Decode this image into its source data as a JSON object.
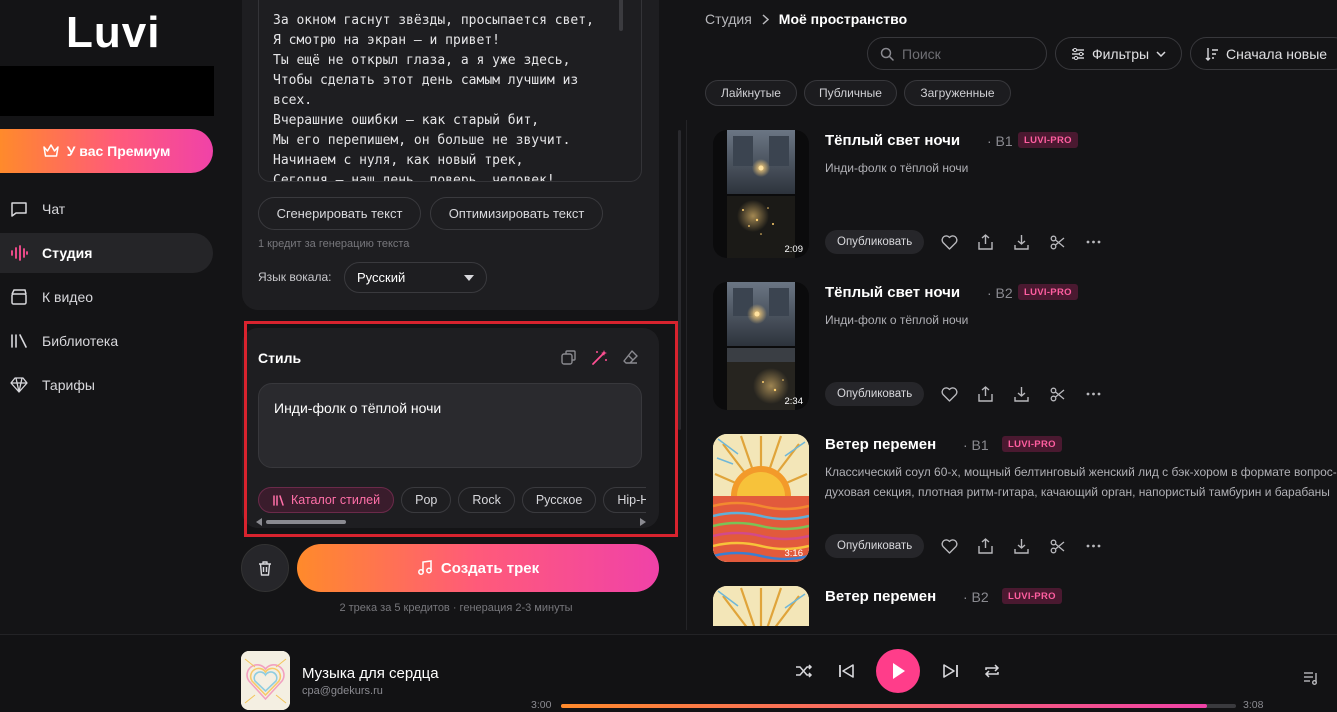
{
  "app": {
    "name": "Luvi"
  },
  "sidebar": {
    "premium_label": "У вас Премиум",
    "items": [
      {
        "label": "Чат",
        "icon": "chat-icon"
      },
      {
        "label": "Студия",
        "icon": "studio-icon",
        "active": true
      },
      {
        "label": "К видео",
        "icon": "video-icon"
      },
      {
        "label": "Библиотека",
        "icon": "library-icon"
      },
      {
        "label": "Тарифы",
        "icon": "diamond-icon"
      }
    ]
  },
  "lyrics": {
    "text": "За окном гаснут звёзды, просыпается свет,\nЯ смотрю на экран — и привет!\nТы ещё не открыл глаза, а я уже здесь,\nЧтобы сделать этот день самым лучшим из\nвсех.\nВчерашние ошибки — как старый бит,\nМы его перепишем, он больше не звучит.\nНачинаем с нуля, как новый трек,\nСегодня — наш день, поверь, человек!",
    "generate_label": "Сгенерировать текст",
    "optimize_label": "Оптимизировать текст",
    "credit_note": "1 кредит за генерацию текста",
    "vocal_language_label": "Язык вокала:",
    "vocal_language_value": "Русский"
  },
  "style": {
    "title": "Стиль",
    "value": "Инди-фолк о тёплой ночи",
    "chips": [
      "Каталог стилей",
      "Pop",
      "Rock",
      "Русское",
      "Hip-H"
    ]
  },
  "create": {
    "label": "Создать трек",
    "note": "2 трека за 5 кредитов · генерация 2-3 минуты"
  },
  "right": {
    "breadcrumb_root": "Студия",
    "breadcrumb_current": "Моё пространство",
    "search_placeholder": "Поиск",
    "filters_label": "Фильтры",
    "sort_label": "Сначала новые",
    "tags": [
      "Лайкнутые",
      "Публичные",
      "Загруженные"
    ],
    "publish_label": "Опубликовать",
    "tracks": [
      {
        "title": "Тёплый свет ночи",
        "version": "· B1",
        "badge": "LUVI-PRO",
        "description": "Инди-фолк о тёплой ночи",
        "duration": "2:09",
        "cover": "night"
      },
      {
        "title": "Тёплый свет ночи",
        "version": "· B2",
        "badge": "LUVI-PRO",
        "description": "Инди-фолк о тёплой ночи",
        "duration": "2:34",
        "cover": "night"
      },
      {
        "title": "Ветер перемен",
        "version": "· B1",
        "badge": "LUVI-PRO",
        "description": "Классический соул 60-х, мощный белтинговый женский лид с бэк-хором в формате вопрос-ответ,\nдуховая секция, плотная ритм-гитара, качающий орган, напористый тамбурин и барабаны",
        "duration": "3:16",
        "cover": "sun"
      },
      {
        "title": "Ветер перемен",
        "version": "· B2",
        "badge": "LUVI-PRO",
        "description": "",
        "duration": "",
        "cover": "sun"
      }
    ]
  },
  "player": {
    "title": "Музыка для сердца",
    "artist": "cpa@gdekurs.ru",
    "time_current": "3:00",
    "time_total": "3:08",
    "progress": 0.957
  },
  "colors": {
    "accent_pink": "#ff3d8a",
    "accent_orange": "#ff8a2b",
    "badge_text": "#ff5ea0",
    "highlight": "#d8232e"
  }
}
